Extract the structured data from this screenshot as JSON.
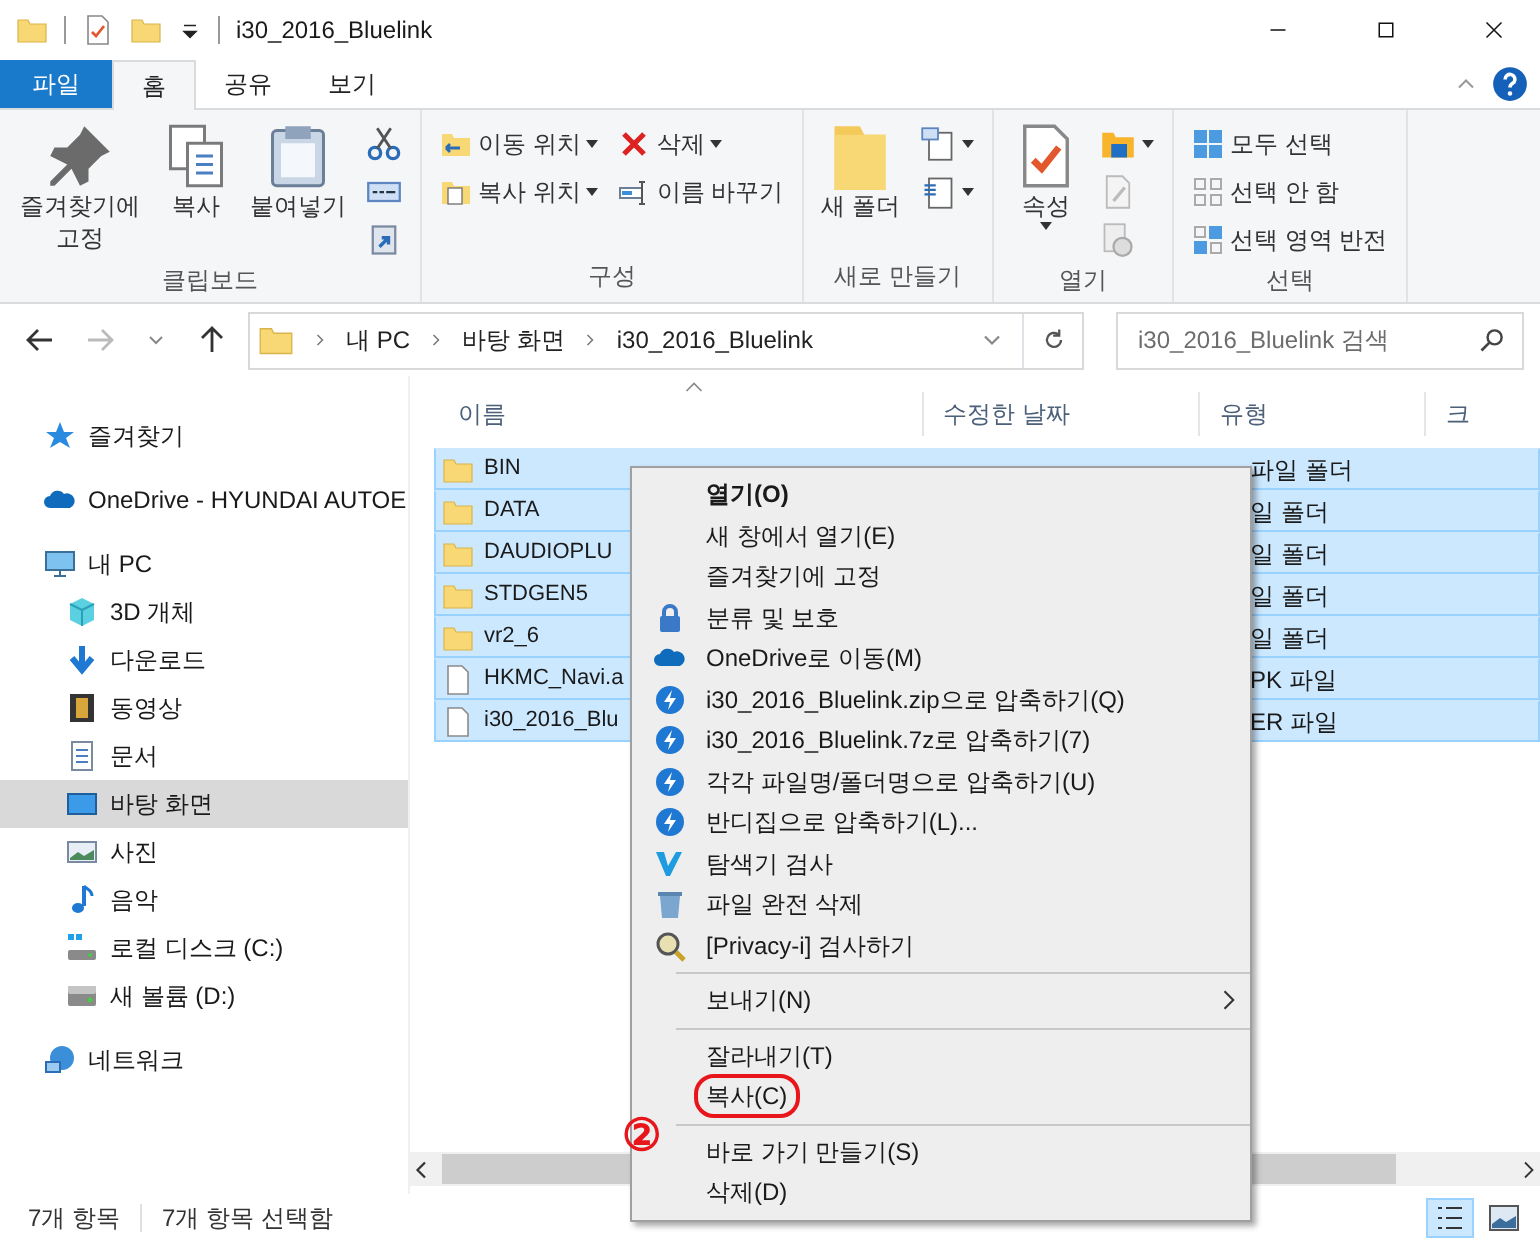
{
  "window": {
    "title": "i30_2016_Bluelink"
  },
  "ribbon": {
    "tabs": [
      {
        "label": "파일",
        "kind": "file",
        "selected": false
      },
      {
        "label": "홈",
        "kind": "tab",
        "selected": true
      },
      {
        "label": "공유",
        "kind": "tab",
        "selected": false
      },
      {
        "label": "보기",
        "kind": "tab",
        "selected": false
      }
    ],
    "groups": [
      {
        "label": "클립보드",
        "big": [
          {
            "label": "즐겨찾기에 고정",
            "kind": "pin",
            "dropdown": false
          },
          {
            "label": "복사",
            "kind": "copy",
            "dropdown": false
          },
          {
            "label": "붙여넣기",
            "kind": "paste",
            "dropdown": false
          }
        ],
        "small_columns": [
          [
            {
              "kind": "scissors",
              "dropdown": false
            },
            {
              "kind": "path",
              "dropdown": false
            },
            {
              "kind": "shortcut",
              "dropdown": false
            }
          ]
        ]
      },
      {
        "label": "구성",
        "small_columns": [
          [
            {
              "label": "이동 위치",
              "kind": "move",
              "dropdown": true
            },
            {
              "label": "복사 위치",
              "kind": "copyto",
              "dropdown": true
            }
          ],
          [
            {
              "label": "삭제",
              "kind": "delete",
              "dropdown": true
            },
            {
              "label": "이름 바꾸기",
              "kind": "rename",
              "dropdown": false
            }
          ]
        ]
      },
      {
        "label": "새로 만들기",
        "big": [
          {
            "label": "새 폴더",
            "kind": "newfolder",
            "dropdown": false
          }
        ],
        "small_columns": [
          [
            {
              "kind": "newitem",
              "dropdown": true
            },
            {
              "kind": "easyaccess",
              "dropdown": true
            }
          ]
        ]
      },
      {
        "label": "열기",
        "big": [
          {
            "label": "속성",
            "kind": "properties",
            "dropdown": true
          }
        ],
        "small_columns": [
          [
            {
              "kind": "open",
              "dropdown": true
            },
            {
              "kind": "edit",
              "dropdown": false
            },
            {
              "kind": "history",
              "dropdown": false
            }
          ]
        ]
      },
      {
        "label": "선택",
        "small_columns": [
          [
            {
              "label": "모두 선택",
              "kind": "selectall",
              "dropdown": false
            },
            {
              "label": "선택 안 함",
              "kind": "selectnone",
              "dropdown": false
            },
            {
              "label": "선택 영역 반전",
              "kind": "invert",
              "dropdown": false
            }
          ]
        ]
      }
    ]
  },
  "address": {
    "breadcrumbs": [
      "내 PC",
      "바탕 화면",
      "i30_2016_Bluelink"
    ],
    "search": {
      "placeholder": "i30_2016_Bluelink 검색"
    }
  },
  "sidebar": {
    "items": [
      {
        "label": "즐겨찾기",
        "kind": "star",
        "selected": false
      },
      {
        "label": "OneDrive - HYUNDAI AUTOE",
        "kind": "cloud",
        "selected": false
      },
      {
        "label": "내 PC",
        "kind": "pc",
        "selected": false,
        "children": [
          {
            "label": "3D 개체",
            "kind": "cube",
            "selected": false
          },
          {
            "label": "다운로드",
            "kind": "download",
            "selected": false
          },
          {
            "label": "동영상",
            "kind": "film",
            "selected": false
          },
          {
            "label": "문서",
            "kind": "doc",
            "selected": false
          },
          {
            "label": "바탕 화면",
            "kind": "desktop",
            "selected": true
          },
          {
            "label": "사진",
            "kind": "picture",
            "selected": false
          },
          {
            "label": "음악",
            "kind": "music",
            "selected": false
          },
          {
            "label": "로컬 디스크 (C:)",
            "kind": "systemdrive",
            "selected": false
          },
          {
            "label": "새 볼륨 (D:)",
            "kind": "drive",
            "selected": false
          }
        ]
      },
      {
        "label": "네트워크",
        "kind": "network",
        "selected": false
      }
    ]
  },
  "table": {
    "columns": [
      "이름",
      "수정한 날짜",
      "유형",
      "크"
    ],
    "rows": [
      {
        "name": "BIN",
        "kind": "folder",
        "type": "파일 폴더",
        "selected": true
      },
      {
        "name": "DATA",
        "kind": "folder",
        "type": "일 폴더",
        "selected": true
      },
      {
        "name": "DAUDIOPLU",
        "kind": "folder",
        "type": "일 폴더",
        "selected": true
      },
      {
        "name": "STDGEN5",
        "kind": "folder",
        "type": "일 폴더",
        "selected": true
      },
      {
        "name": "vr2_6",
        "kind": "folder",
        "type": "일 폴더",
        "selected": true
      },
      {
        "name": "HKMC_Navi.a",
        "kind": "file",
        "type": "PK 파일",
        "selected": true
      },
      {
        "name": "i30_2016_Blu",
        "kind": "file",
        "type": "ER 파일",
        "selected": true
      }
    ]
  },
  "context_menu": {
    "items": [
      {
        "kind": "plain",
        "label": "열기(O)",
        "default": true
      },
      {
        "kind": "plain",
        "label": "새 창에서 열기(E)",
        "default": false
      },
      {
        "kind": "plain",
        "label": "즐겨찾기에 고정",
        "default": false
      },
      {
        "kind": "lock",
        "label": "분류 및 보호",
        "default": false
      },
      {
        "kind": "cloud",
        "label": "OneDrive로 이동(M)",
        "default": false
      },
      {
        "kind": "zip",
        "label": "i30_2016_Bluelink.zip으로 압축하기(Q)",
        "default": false
      },
      {
        "kind": "zip",
        "label": "i30_2016_Bluelink.7z로 압축하기(7)",
        "default": false
      },
      {
        "kind": "zip",
        "label": "각각 파일명/폴더명으로 압축하기(U)",
        "default": false
      },
      {
        "kind": "zip",
        "label": "반디집으로 압축하기(L)...",
        "default": false
      },
      {
        "kind": "scan",
        "label": "탐색기 검사",
        "default": false
      },
      {
        "kind": "shred",
        "label": "파일 완전 삭제",
        "default": false
      },
      {
        "kind": "privacy",
        "label": "[Privacy-i] 검사하기",
        "default": false
      },
      {
        "kind": "separator"
      },
      {
        "kind": "submenu",
        "label": "보내기(N)",
        "default": false
      },
      {
        "kind": "separator"
      },
      {
        "kind": "plain",
        "label": "잘라내기(T)",
        "default": false
      },
      {
        "kind": "plain",
        "label": "복사(C)",
        "default": false,
        "marked": true
      },
      {
        "kind": "separator"
      },
      {
        "kind": "plain",
        "label": "바로 가기 만들기(S)",
        "default": false
      },
      {
        "kind": "plain",
        "label": "삭제(D)",
        "default": false
      }
    ]
  },
  "annotation": {
    "number": "②"
  },
  "status_bar": {
    "count": "7개 항목",
    "selection": "7개 항목 선택함",
    "views": [
      {
        "kind": "details",
        "selected": true
      },
      {
        "kind": "large",
        "selected": false
      }
    ]
  }
}
